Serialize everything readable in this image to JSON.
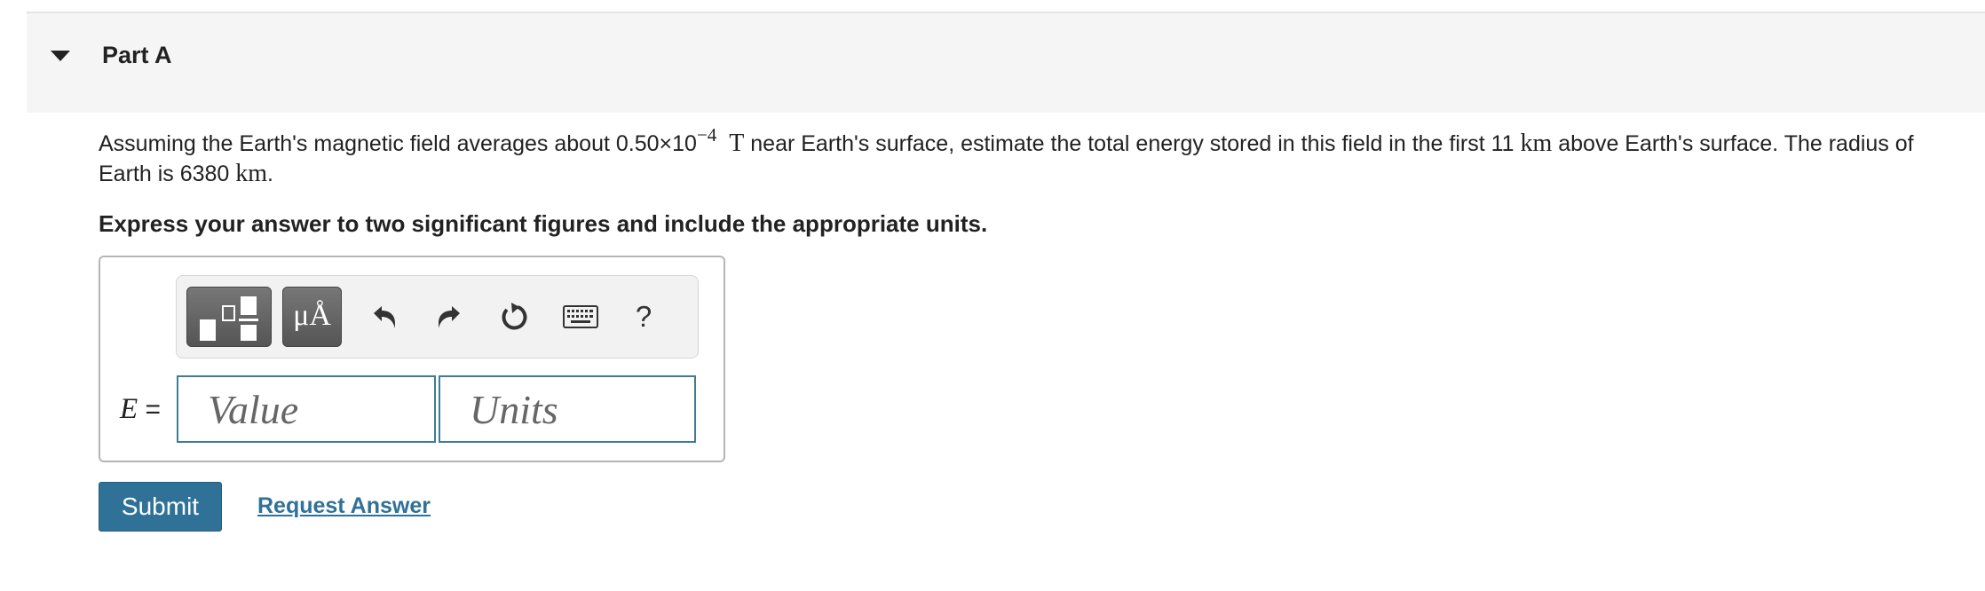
{
  "part": {
    "title": "Part A"
  },
  "question": {
    "text_1": "Assuming the Earth's magnetic field averages about 0.50",
    "times": "×",
    "ten": "10",
    "exponent": "−4",
    "unit_T": "T",
    "text_2": " near Earth's surface, estimate the total energy stored in this field in the first 11 ",
    "unit_km1": "km",
    "text_3": " above Earth's surface. The radius of Earth is 6380 ",
    "unit_km2": "km",
    "text_4": "."
  },
  "instruction": "Express your answer to two significant figures and include the appropriate units.",
  "toolbar": {
    "symbols_label": "μÅ",
    "help_label": "?",
    "icons": [
      "templates-icon",
      "symbols-icon",
      "undo-icon",
      "redo-icon",
      "reset-icon",
      "keyboard-icon",
      "help-icon"
    ]
  },
  "answer": {
    "variable": "E",
    "equals": " =",
    "value_placeholder": "Value",
    "units_placeholder": "Units"
  },
  "actions": {
    "submit_label": "Submit",
    "request_label": "Request Answer"
  },
  "colors": {
    "accent": "#2f7197",
    "input_border": "#3f7c96",
    "header_bg": "#f5f5f5"
  }
}
